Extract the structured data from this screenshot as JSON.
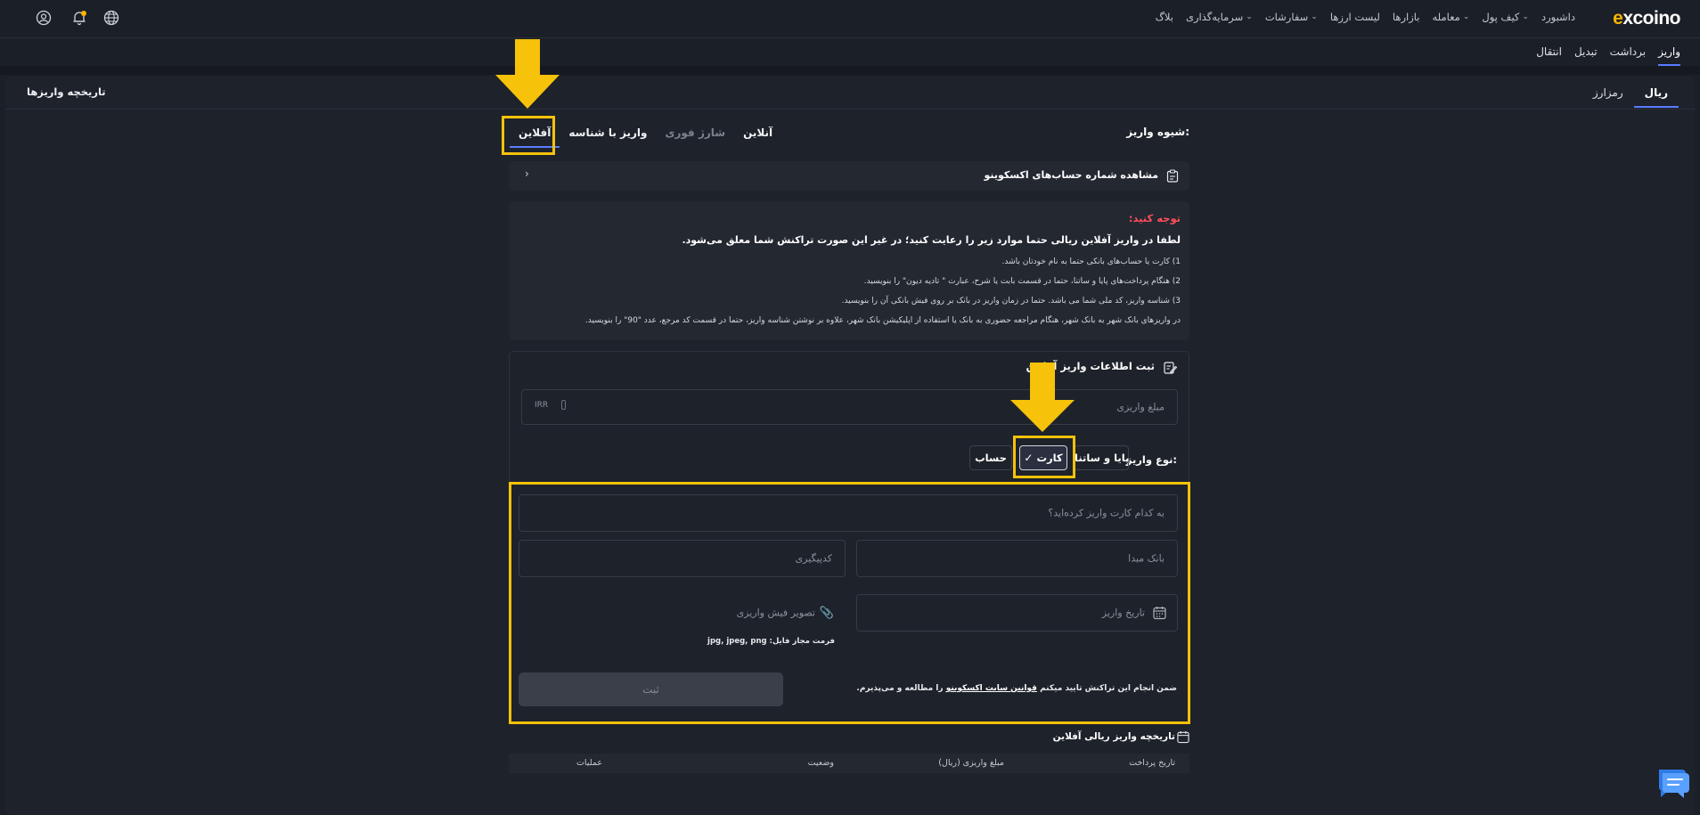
{
  "header": {
    "logo": {
      "prefix": "e",
      "name": "xcoino"
    },
    "nav": [
      {
        "label": "داشبورد",
        "caret": false
      },
      {
        "label": "کیف پول",
        "caret": true
      },
      {
        "label": "معامله",
        "caret": true
      },
      {
        "label": "بازارها",
        "caret": false
      },
      {
        "label": "لیست ارزها",
        "caret": false
      },
      {
        "label": "سفارشات",
        "caret": true
      },
      {
        "label": "سرمایه‌گذاری",
        "caret": true
      },
      {
        "label": "بلاگ",
        "caret": false
      }
    ],
    "icons": [
      "globe-icon",
      "bell-icon",
      "user-icon"
    ]
  },
  "subtabs": [
    "واریز",
    "برداشت",
    "تبدیل",
    "انتقال"
  ],
  "history_link": "تاریخچه واریزها",
  "currency_tabs": [
    "ریال",
    "رمزارز"
  ],
  "method": {
    "label": "شیوه واریز:",
    "tabs": [
      "آنلاین",
      "شارژ فوری",
      "واریز با شناسه",
      "آفلاین"
    ]
  },
  "accounts_card": {
    "text": "مشاهده شماره حساب‌های اکسکوینو"
  },
  "notice": {
    "title": "توجه کنید:",
    "main": "لطفا در واریز آفلاین ریالی حتما موارد زیر را رعایت کنید؛ در غیر این صورت تراکنش شما معلق می‌شود.",
    "lines": [
      "1) کارت یا حساب‌های بانکی حتما به نام خودتان باشد.",
      "2) هنگام پرداخت‌های پایا و ساتنا، حتما در قسمت بابت یا شرح، عبارت \" تادیه دیون\" را بنویسید.",
      "3) شناسه واریز، کد ملی شما می باشد. حتما در زمان واریز در بانک بر روی فیش بانکی آن را بنویسید.",
      "در واریزهای بانک شهر به بانک شهر، هنگام مراجعه حضوری به بانک یا استفاده از اپلیکیشن بانک شهر، علاوه بر نوشتن شناسه واریز، حتما در قسمت کد مرجع، عدد \"90\" را بنویسید."
    ]
  },
  "form": {
    "title": "ثبت اطلاعات واریز آفلاین",
    "amount_placeholder": "مبلغ واریزی",
    "amount_unit": "IRR",
    "type_label": "نوع واریز:",
    "types": [
      "پایا و ساتنا",
      "کارت",
      "حساب"
    ],
    "selected_type": "کارت",
    "card_placeholder": "به کدام کارت واریز کرده‌اید؟",
    "bank_placeholder": "بانک مبدا",
    "tracking_placeholder": "کدپیگیری",
    "date_placeholder": "تاریخ واریز",
    "receipt_placeholder": "تصویر فیش واریزی",
    "format_label": "فرمت مجاز فایل:",
    "format_value": "jpg, jpeg, png",
    "terms_prefix": "ضمن انجام این تراکنش تایید میکنم",
    "terms_link": "قوانین سایت اکسکوینو",
    "terms_suffix": "را مطالعه و می‌پذیرم.",
    "submit": "ثبت"
  },
  "history": {
    "title": "تاریخچه واریز ریالی آفلاین",
    "columns": [
      "تاریخ پرداخت",
      "مبلغ واریزی (ریال)",
      "وضعیت",
      "عملیات"
    ]
  },
  "colors": {
    "accent": "#5a7bff",
    "highlight": "#f6c20a",
    "warning": "#ff4d5a",
    "brand": "#f7b500"
  }
}
